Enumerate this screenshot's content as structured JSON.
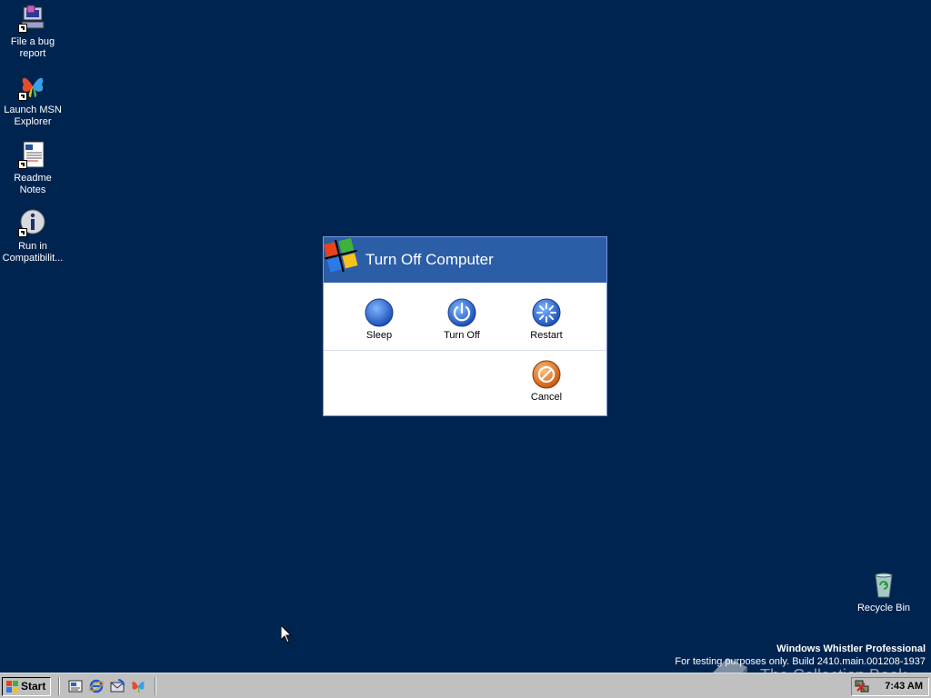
{
  "desktop": {
    "background": "#002450",
    "icons": [
      {
        "label": "File a bug report",
        "icon": "bug-report-icon"
      },
      {
        "label": "Launch MSN Explorer",
        "icon": "msn-butterfly-icon"
      },
      {
        "label": "Readme Notes",
        "icon": "notes-icon"
      },
      {
        "label": "Run in Compatibilit...",
        "icon": "info-icon"
      },
      {
        "label": "Recycle Bin",
        "icon": "recycle-bin-icon"
      }
    ]
  },
  "dialog": {
    "title": "Turn Off Computer",
    "header_color": "#2c5ea8",
    "options": [
      {
        "label": "Sleep",
        "icon": "sleep-moon-icon"
      },
      {
        "label": "Turn Off",
        "icon": "power-icon"
      },
      {
        "label": "Restart",
        "icon": "restart-icon"
      }
    ],
    "cancel_label": "Cancel"
  },
  "watermark": {
    "line1": "Windows Whistler Professional",
    "line2": "For testing purposes only. Build 2410.main.001208-1937",
    "overlay": "The Collection Book"
  },
  "taskbar": {
    "start_label": "Start",
    "quick_launch": [
      "show-desktop-icon",
      "internet-explorer-icon",
      "outlook-express-icon",
      "msn-explorer-icon"
    ],
    "clock": "7:43 AM"
  }
}
